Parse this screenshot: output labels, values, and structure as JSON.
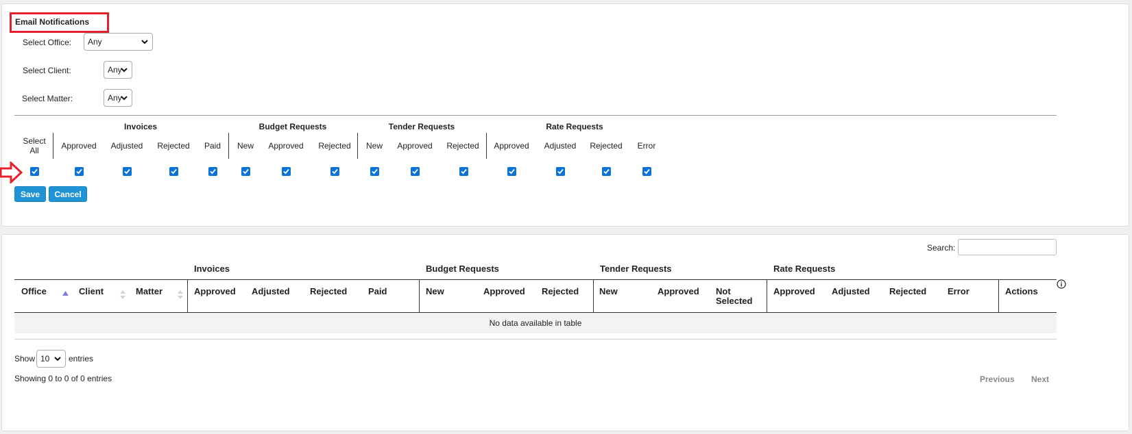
{
  "form": {
    "title": "Email Notifications",
    "office_label": "Select Office:",
    "office_value": "Any",
    "client_label": "Select Client:",
    "client_value": "Any",
    "matter_label": "Select Matter:",
    "matter_value": "Any"
  },
  "checkbox_grid": {
    "select_all_line1": "Select",
    "select_all_line2": "All",
    "groups": [
      "Invoices",
      "Budget Requests",
      "Tender Requests",
      "Rate Requests"
    ],
    "columns": [
      "Approved",
      "Adjusted",
      "Rejected",
      "Paid",
      "New",
      "Approved",
      "Rejected",
      "New",
      "Approved",
      "Rejected",
      "Approved",
      "Adjusted",
      "Rejected",
      "Error"
    ],
    "all_checked": true
  },
  "buttons": {
    "save": "Save",
    "cancel": "Cancel"
  },
  "table": {
    "search_label": "Search:",
    "search_value": "",
    "groups": [
      "Invoices",
      "Budget Requests",
      "Tender Requests",
      "Rate Requests"
    ],
    "headers": {
      "office": "Office",
      "client": "Client",
      "matter": "Matter",
      "inv_approved": "Approved",
      "inv_adjusted": "Adjusted",
      "inv_rejected": "Rejected",
      "inv_paid": "Paid",
      "bud_new": "New",
      "bud_approved": "Approved",
      "bud_rejected": "Rejected",
      "ten_new": "New",
      "ten_approved": "Approved",
      "ten_not_selected_1": "Not",
      "ten_not_selected_2": "Selected",
      "rate_approved": "Approved",
      "rate_adjusted": "Adjusted",
      "rate_rejected": "Rejected",
      "rate_error": "Error",
      "actions": "Actions"
    },
    "empty_message": "No data available in table",
    "show_label": "Show",
    "page_size": "10",
    "entries_label": "entries",
    "info": "Showing 0 to 0 of 0 entries",
    "previous": "Previous",
    "next": "Next"
  },
  "colors": {
    "accent": "#1f93d3",
    "highlight": "#e3202b",
    "checkbox": "#0b72d8"
  }
}
